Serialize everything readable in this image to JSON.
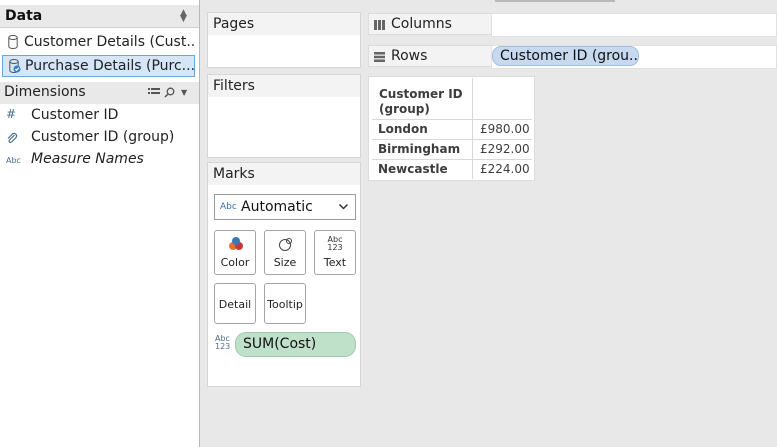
{
  "data_pane": {
    "title": "Data",
    "datasources": [
      {
        "label": "Customer Details (Cust..."
      },
      {
        "label": "Purchase Details (Purc..."
      }
    ]
  },
  "dimensions": {
    "title": "Dimensions",
    "items": [
      {
        "icon": "#",
        "label": "Customer ID"
      },
      {
        "label": "Customer ID (group)"
      },
      {
        "icon": "Abc",
        "label": "Measure Names"
      }
    ]
  },
  "cards": {
    "pages": "Pages",
    "filters": "Filters",
    "marks": "Marks"
  },
  "marks": {
    "type_icon": "Abc",
    "type": "Automatic",
    "buttons": {
      "color": "Color",
      "size": "Size",
      "text": "Text",
      "text_icon_top": "Abc",
      "text_icon_bottom": "123",
      "detail": "Detail",
      "tooltip": "Tooltip"
    },
    "pill_icon_top": "Abc",
    "pill_icon_bottom": "123",
    "pill": "SUM(Cost)",
    "pill_color": "#bfe1ca"
  },
  "shelves": {
    "columns": "Columns",
    "rows": "Rows",
    "rows_pill": "Customer ID (grou..",
    "rows_pill_color": "#c6d9ef"
  },
  "crosstab": {
    "header_line1": "Customer ID",
    "header_line2": "(group)",
    "rows": [
      {
        "key": "London",
        "value": "£980.00"
      },
      {
        "key": "Birmingham",
        "value": "£292.00"
      },
      {
        "key": "Newcastle",
        "value": "£224.00"
      }
    ]
  }
}
